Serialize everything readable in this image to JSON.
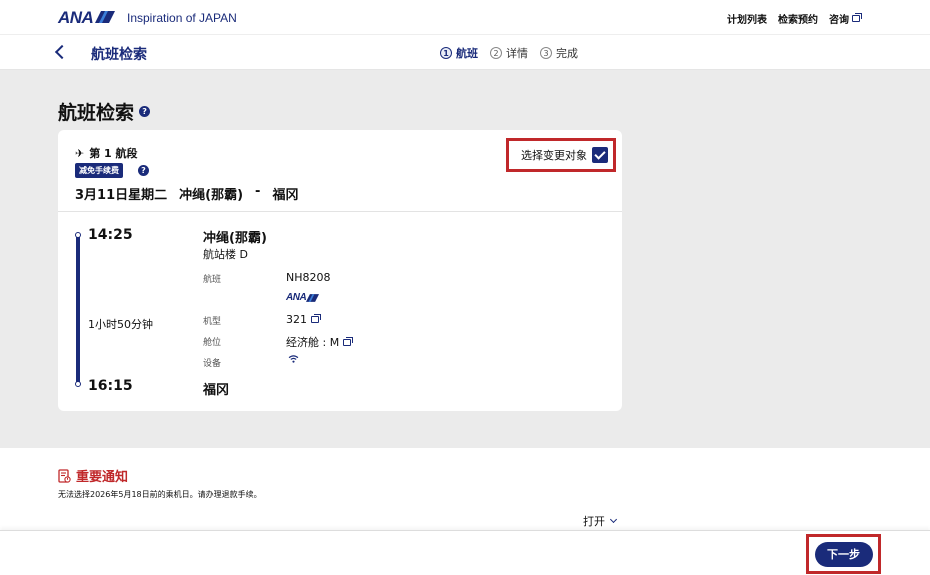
{
  "header": {
    "logo": "ANA",
    "tagline": "Inspiration of JAPAN",
    "links": [
      "计划列表",
      "检索预约",
      "咨询"
    ]
  },
  "subheader": {
    "title": "航班检索",
    "steps": [
      {
        "num": "1",
        "label": "航班"
      },
      {
        "num": "2",
        "label": "详情"
      },
      {
        "num": "3",
        "label": "完成"
      }
    ]
  },
  "main": {
    "title": "航班检索",
    "help": "?"
  },
  "segment": {
    "label": "第 1 航段",
    "fee_badge": "减免手续费",
    "date": "3月11日星期二",
    "origin": "冲绳(那霸)",
    "dash": "-",
    "destination": "福冈",
    "select_label": "选择变更对象"
  },
  "flight": {
    "dep_time": "14:25",
    "arr_time": "16:15",
    "duration": "1小时50分钟",
    "dep_city": "冲绳(那霸)",
    "terminal": "航站楼 D",
    "arr_city": "福冈",
    "label_flight": "航班",
    "flight_no": "NH8208",
    "carrier_logo": "ANA",
    "label_aircraft": "机型",
    "aircraft": "321",
    "label_class": "舱位",
    "cabin": "经济舱 : M",
    "label_facility": "设备"
  },
  "notice": {
    "title": "重要通知",
    "text": "无法选择2026年5月18日前的乘机日。请办理退款手续。",
    "open": "打开"
  },
  "footer": {
    "next": "下一步"
  },
  "colors": {
    "brand": "#1a2b7a",
    "alert": "#c0282a",
    "background": "#ebebeb"
  }
}
